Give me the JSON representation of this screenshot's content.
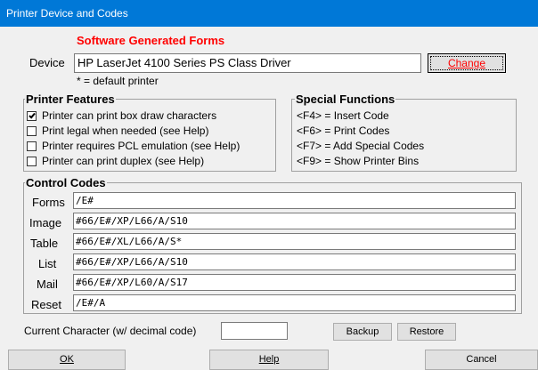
{
  "window": {
    "title": "Printer Device and Codes"
  },
  "header": {
    "subtitle": "Software Generated Forms"
  },
  "device": {
    "label": "Device",
    "value": "HP LaserJet 4100 Series PS Class Driver",
    "change_label": "Change",
    "note": "* = default printer"
  },
  "features": {
    "title": "Printer Features",
    "items": [
      {
        "label": "Printer can print box draw characters",
        "checked": true
      },
      {
        "label": "Print legal when needed (see Help)",
        "checked": false
      },
      {
        "label": "Printer requires PCL emulation (see Help)",
        "checked": false
      },
      {
        "label": "Printer can print duplex (see Help)",
        "checked": false
      }
    ]
  },
  "special": {
    "title": "Special Functions",
    "items": [
      "<F4> = Insert Code",
      "<F6> = Print Codes",
      "<F7> = Add Special Codes",
      "<F9> = Show Printer Bins"
    ]
  },
  "control": {
    "title": "Control Codes",
    "rows": [
      {
        "label": "Forms",
        "value": "/E#"
      },
      {
        "label": "Image",
        "value": "#66/E#/XP/L66/A/S10"
      },
      {
        "label": "Table",
        "value": "#66/E#/XL/L66/A/S*"
      },
      {
        "label": "List",
        "value": "#66/E#/XP/L66/A/S10"
      },
      {
        "label": "Mail",
        "value": "#66/E#/XP/L60/A/S17"
      },
      {
        "label": "Reset",
        "value": "/E#/A"
      }
    ]
  },
  "current_char": {
    "label": "Current Character (w/ decimal code)",
    "value": ""
  },
  "buttons": {
    "backup": "Backup",
    "restore": "Restore",
    "ok": "OK",
    "help": "Help",
    "cancel": "Cancel"
  }
}
